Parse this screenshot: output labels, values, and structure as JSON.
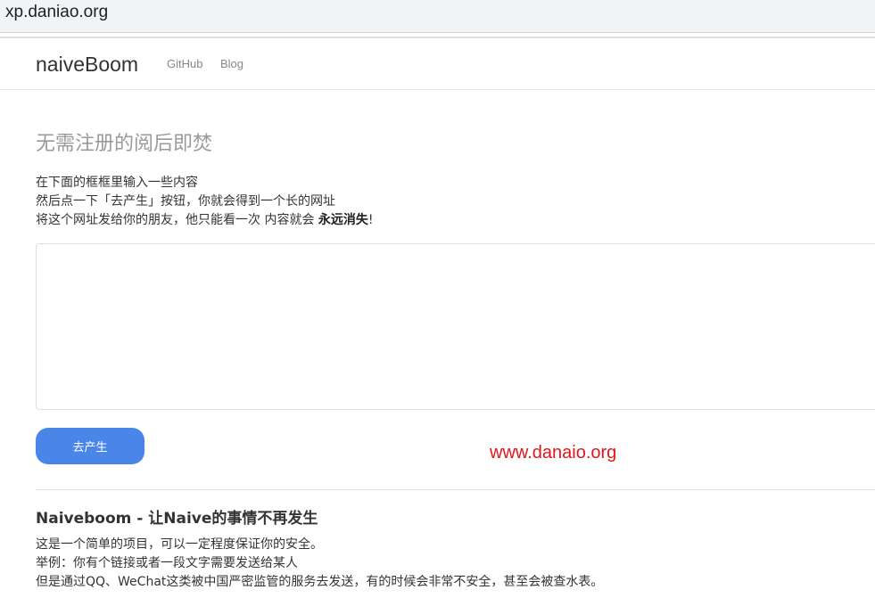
{
  "browser": {
    "url": "xp.daniao.org"
  },
  "navbar": {
    "brand": "naiveBoom",
    "links": [
      {
        "label": "GitHub"
      },
      {
        "label": "Blog"
      }
    ]
  },
  "main": {
    "title": "无需注册的阅后即焚",
    "intro": {
      "line1": "在下面的框框里输入一些内容",
      "line2": "然后点一下「去产生」按钮，你就会得到一个长的网址",
      "line3_prefix": "将这个网址发给你的朋友，他只能看一次 内容就会 ",
      "line3_emphasis": "永远消失",
      "line3_suffix": "!"
    },
    "textarea": {
      "value": "",
      "placeholder": ""
    },
    "submit_label": "去产生",
    "watermark": "www.danaio.org"
  },
  "about": {
    "title": "Naiveboom - 让Naive的事情不再发生",
    "lines": [
      "这是一个简单的项目，可以一定程度保证你的安全。",
      "举例：你有个链接或者一段文字需要发送给某人",
      "但是通过QQ、WeChat这类被中国严密监管的服务去发送，有的时候会非常不安全，甚至会被查水表。"
    ]
  }
}
